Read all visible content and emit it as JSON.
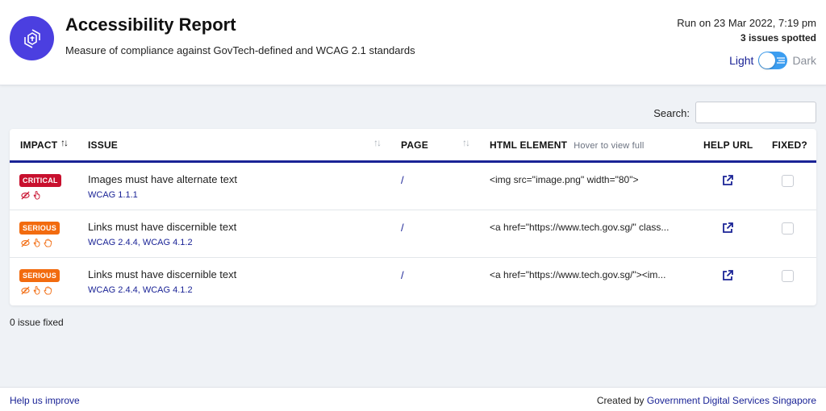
{
  "header": {
    "title": "Accessibility Report",
    "subtitle": "Measure of compliance against GovTech-defined and WCAG 2.1 standards",
    "run_on": "Run on 23 Mar 2022, 7:19 pm",
    "issues_spotted": "3 issues spotted",
    "theme_light": "Light",
    "theme_dark": "Dark"
  },
  "search": {
    "label": "Search:",
    "value": "",
    "placeholder": ""
  },
  "table": {
    "headers": {
      "impact": "IMPACT",
      "issue": "ISSUE",
      "page": "PAGE",
      "html_element": "HTML ELEMENT",
      "html_element_hint": "Hover to view full",
      "help_url": "HELP URL",
      "fixed": "FIXED?"
    },
    "rows": [
      {
        "impact": "CRITICAL",
        "issue": "Images must have alternate text",
        "wcag": "WCAG 1.1.1",
        "page": "/",
        "html_element": "<img src=\"image.png\" width=\"80\">",
        "fixed": false
      },
      {
        "impact": "SERIOUS",
        "issue": "Links must have discernible text",
        "wcag": "WCAG 2.4.4, WCAG 4.1.2",
        "page": "/",
        "html_element": "<a href=\"https://www.tech.gov.sg/\" class...",
        "fixed": false
      },
      {
        "impact": "SERIOUS",
        "issue": "Links must have discernible text",
        "wcag": "WCAG 2.4.4, WCAG 4.1.2",
        "page": "/",
        "html_element": "<a href=\"https://www.tech.gov.sg/\"><im...",
        "fixed": false
      }
    ]
  },
  "fixed_count": "0 issue fixed",
  "footer": {
    "help_improve": "Help us improve",
    "created_by_prefix": "Created by",
    "created_by_link": "Government Digital Services Singapore"
  },
  "colors": {
    "brand": "#4b3fe0",
    "accent": "#1a2396",
    "critical": "#c8102e",
    "serious": "#f26b0f",
    "toggle": "#3b9df0"
  },
  "icons": {
    "logo": "accessibility-logo-icon",
    "impact": [
      "eye-slash-icon",
      "hand-pointer-icon",
      "hand-open-icon"
    ],
    "help": "external-link-icon"
  }
}
